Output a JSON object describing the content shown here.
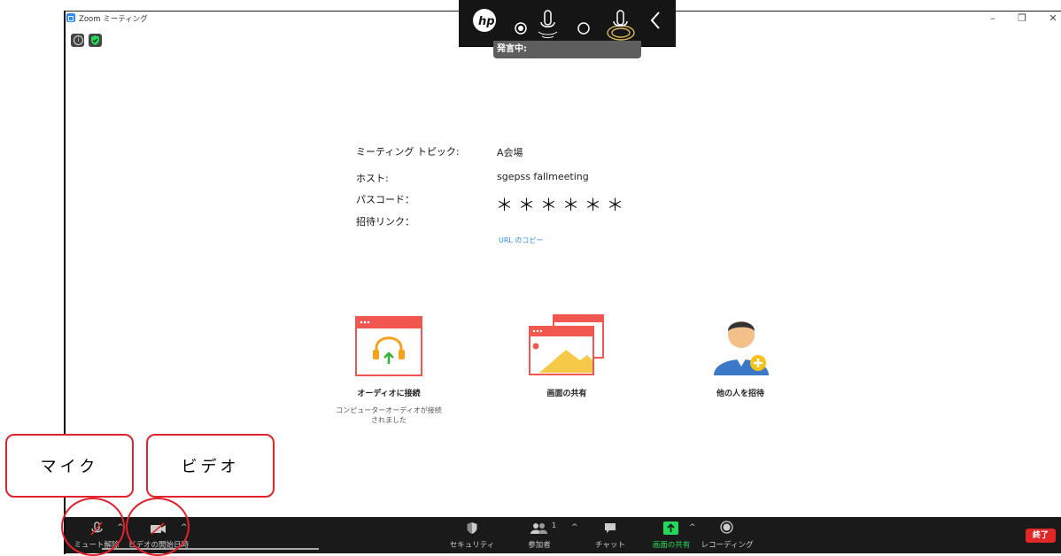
{
  "window": {
    "title": "Zoom ミーティング",
    "minimize_icon": "–",
    "restore_icon": "❐",
    "close_icon": "✕"
  },
  "hp_overlay": {
    "tooltip": "発言中:"
  },
  "meeting_info": {
    "topic_label": "ミーティング トピック:",
    "topic_value": "A会場",
    "host_label": "ホスト:",
    "host_value": "sgepss fallmeeting",
    "passcode_label": "パスコード：",
    "passcode_value": "＊＊＊＊＊＊",
    "invite_label": "招待リンク：",
    "copy_url": "URL のコピー"
  },
  "actions": [
    {
      "label": "オーディオに接続",
      "sub": "コンピューターオーディオが接続されました"
    },
    {
      "label": "画面の共有",
      "sub": ""
    },
    {
      "label": "他の人を招待",
      "sub": ""
    }
  ],
  "annotations": {
    "mic": "マイク",
    "video": "ビデオ"
  },
  "toolbar": {
    "unmute": "ミュート解除",
    "start_video": "ビデオの開始日時",
    "security": "セキュリティ",
    "participants": "参加者",
    "participants_count": "1",
    "chat": "チャット",
    "share_screen": "画面の共有",
    "recording": "レコーディング",
    "end": "終了"
  },
  "colors": {
    "toolbar_bg": "#1a1a1a",
    "share_green": "#23d959",
    "end_red": "#e02828",
    "annotation_red": "#e3232c",
    "zoom_blue": "#2d8cff"
  }
}
